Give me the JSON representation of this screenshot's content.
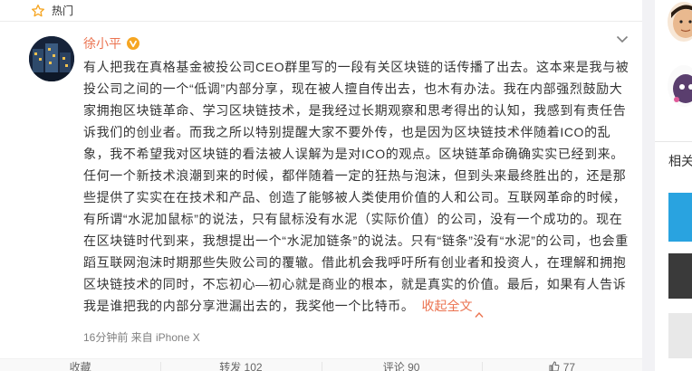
{
  "hot": {
    "label": "热门",
    "icon": "star-outline-icon"
  },
  "post": {
    "username": "徐小平",
    "verified_icon": "verified-v-badge-icon",
    "text": "有人把我在真格基金被投公司CEO群里写的一段有关区块链的话传播了出去。这本来是我与被投公司之间的一个“低调”内部分享，现在被人擅自传出去，也木有办法。我在内部强烈鼓励大家拥抱区块链革命、学习区块链技术，是我经过长期观察和思考得出的认知，我感到有责任告诉我们的创业者。而我之所以特别提醒大家不要外传，也是因为区块链技术伴随着ICO的乱象，我不希望我对区块链的看法被人误解为是对ICO的观点。区块链革命确确实实已经到来。任何一个新技术浪潮到来的时候，都伴随着一定的狂热与泡沫，但到头来最终胜出的，还是那些提供了实实在在技术和产品、创造了能够被人类使用价值的人和公司。互联网革命的时候，有所谓“水泥加鼠标”的说法，只有鼠标没有水泥（实际价值）的公司，没有一个成功的。现在在区块链时代到来，我想提出一个“水泥加链条”的说法。只有“链条”没有“水泥”的公司，也会重蹈互联网泡沫时期那些失败公司的覆辙。借此机会我呼吁所有创业者和投资人，在理解和拥抱区块链技术的同时，不忘初心—初心就是商业的根本，就是真实的价值。最后，如果有人告诉我是谁把我的内部分享泄漏出去的，我奖他一个比特币。",
    "collapse_label": "收起全文",
    "meta": "16分钟前 来自 iPhone X"
  },
  "actions": {
    "favorite": "收藏",
    "repost": "转发 102",
    "comment": "评论 90",
    "like": "77"
  },
  "sidebar": {
    "section_title": "相关"
  },
  "colors": {
    "accent": "#eb7350",
    "verified": "#f6a623",
    "text": "#333333",
    "meta": "#808080"
  }
}
